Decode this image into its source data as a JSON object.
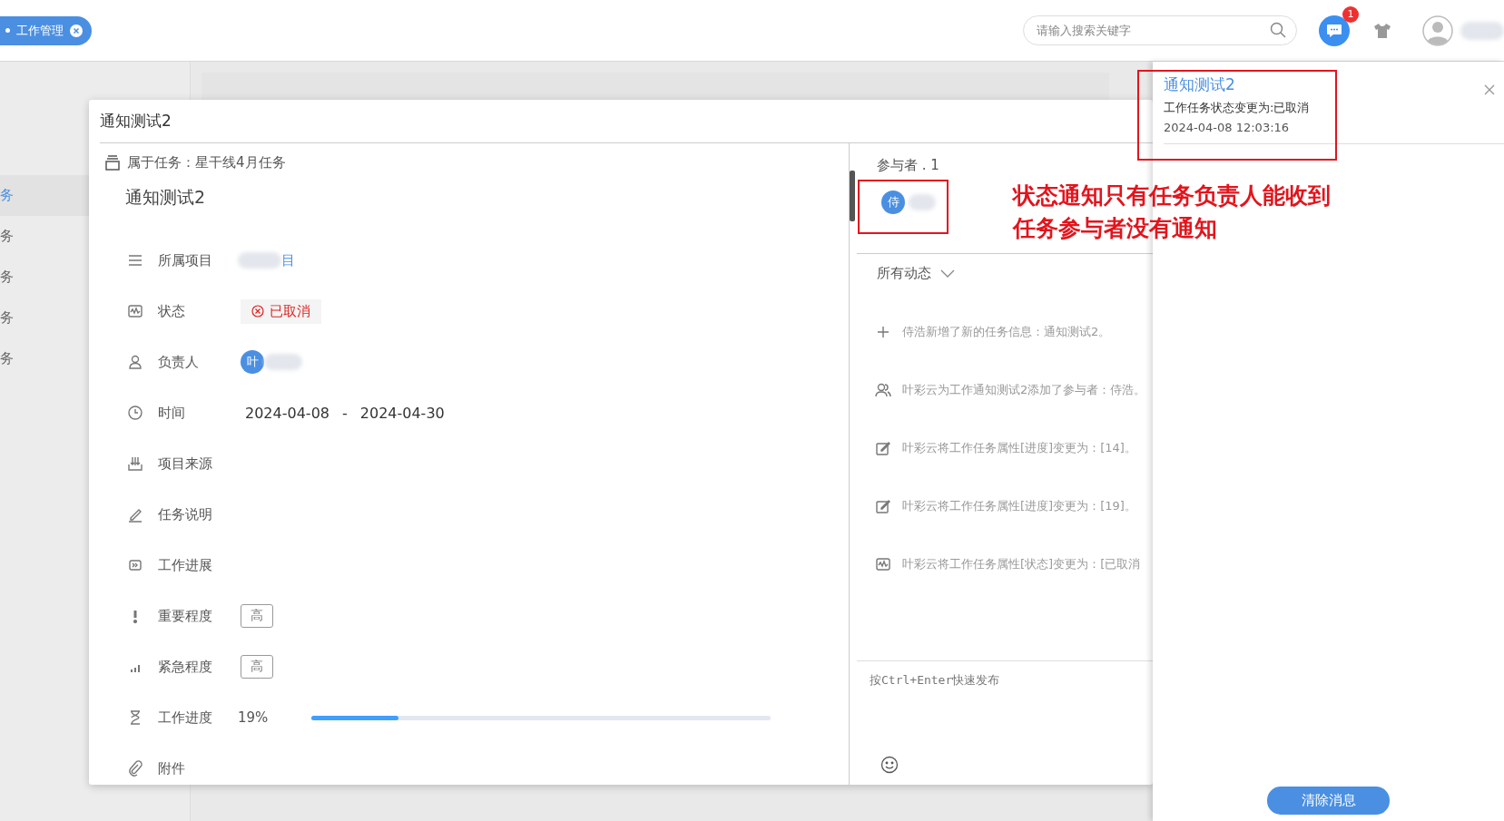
{
  "top_bar": {
    "tab": {
      "label": "工作管理"
    },
    "search": {
      "placeholder": "请输入搜索关键字"
    },
    "message_badge": "1"
  },
  "sidebar": {
    "items": [
      {
        "label": "务",
        "selected": true
      },
      {
        "label": "务",
        "selected": false
      },
      {
        "label": "务",
        "selected": false
      },
      {
        "label": "务",
        "selected": false
      },
      {
        "label": "务",
        "selected": false
      }
    ]
  },
  "task_dialog": {
    "title": "通知测试2",
    "parent_task": "属于任务：星干线4月任务",
    "task_name": "通知测试2",
    "fields": [
      {
        "kind": "project",
        "label": "所属项目",
        "value": "目"
      },
      {
        "kind": "status",
        "label": "状态",
        "value": "已取消"
      },
      {
        "kind": "owner",
        "label": "负责人",
        "avatar": "叶"
      },
      {
        "kind": "time",
        "label": "时间",
        "start": "2024-04-08",
        "separator": "-",
        "end": "2024-04-30"
      },
      {
        "kind": "plain",
        "label": "项目来源"
      },
      {
        "kind": "plain",
        "label": "任务说明"
      },
      {
        "kind": "plain",
        "label": "工作进展"
      },
      {
        "kind": "tag",
        "label": "重要程度",
        "value": "高"
      },
      {
        "kind": "tag",
        "label": "紧急程度",
        "value": "高"
      },
      {
        "kind": "progress",
        "label": "工作进度",
        "value": "19%",
        "level": 0.19
      },
      {
        "kind": "plain",
        "label": "附件"
      }
    ],
    "participants": {
      "title": "参与者 . 1",
      "items": [
        {
          "avatar": "侍"
        }
      ]
    },
    "activity": {
      "filter": "所有动态",
      "items": [
        {
          "kind": "create",
          "text": "侍浩新增了新的任务信息：通知测试2。"
        },
        {
          "kind": "participant",
          "text": "叶彩云为工作通知测试2添加了参与者：侍浩。"
        },
        {
          "kind": "edit",
          "text": "叶彩云将工作任务属性[进度]变更为：[14]。"
        },
        {
          "kind": "edit",
          "text": "叶彩云将工作任务属性[进度]变更为：[19]。"
        },
        {
          "kind": "status",
          "text": "叶彩云将工作任务属性[状态]变更为：[已取消"
        }
      ]
    },
    "comment": {
      "placeholder": "按Ctrl+Enter快速发布"
    }
  },
  "notification_panel": {
    "items": [
      {
        "title": "通知测试2",
        "message": "工作任务状态变更为:已取消",
        "time": "2024-04-08 12:03:16"
      }
    ],
    "clear_button": "清除消息"
  },
  "annotation": {
    "lines": [
      "状态通知只有任务负责人能收到",
      "任务参与者没有通知"
    ]
  }
}
